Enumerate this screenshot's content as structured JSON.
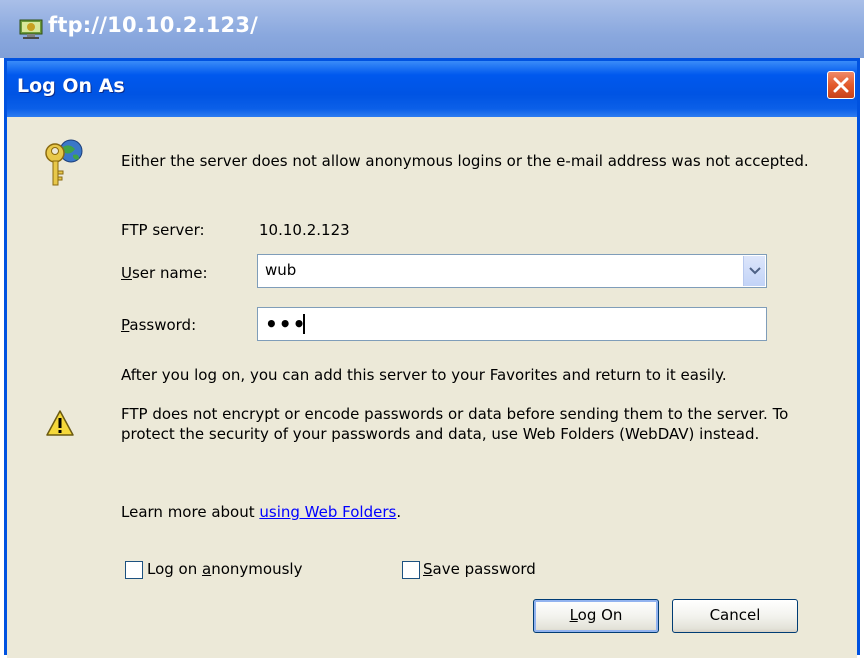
{
  "background_window": {
    "title": "ftp://10.10.2.123/",
    "icon": "ftp-folder-icon"
  },
  "dialog": {
    "title": "Log On As",
    "close_icon": "close-icon",
    "intro": "Either the server does not allow anonymous logins or the e-mail address was not accepted.",
    "ftp_server_label": "FTP server:",
    "ftp_server_value": "10.10.2.123",
    "username_label_prefix": "U",
    "username_label_rest": "ser name:",
    "username_value": "wub",
    "password_label_prefix": "P",
    "password_label_rest": "assword:",
    "password_value": "•••",
    "favorites_note": "After you log on, you can add this server to your Favorites and return to it easily.",
    "warning": "FTP does not encrypt or encode passwords or data before sending them to the server.  To protect the security of your passwords and data, use Web Folders (WebDAV) instead.",
    "learn_more_prefix": "Learn more about ",
    "learn_more_link": "using Web Folders",
    "learn_more_suffix": ".",
    "anonymous_label_pre": "Log on ",
    "anonymous_label_u": "a",
    "anonymous_label_post": "nonymously",
    "anonymous_checked": false,
    "save_password_label_u": "S",
    "save_password_label_post": "ave password",
    "save_password_checked": false,
    "logon_button_u": "L",
    "logon_button_post": "og On",
    "cancel_button": "Cancel"
  },
  "colors": {
    "title_bar": "#0054e3",
    "dialog_bg": "#ece9d8",
    "link": "#0000ff",
    "close_button": "#e35a2c"
  }
}
